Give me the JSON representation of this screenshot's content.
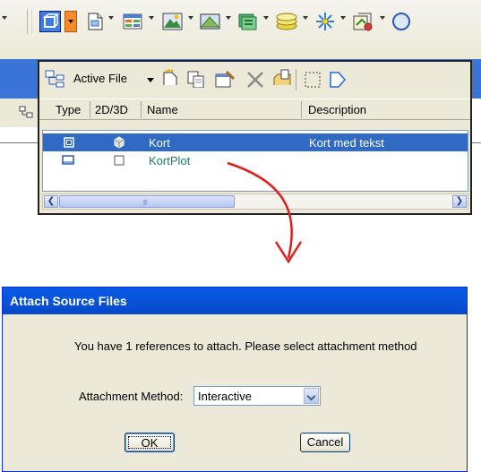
{
  "toolbar": {
    "icons": [
      "reference-icon",
      "models-icon",
      "level-manager-icon",
      "raster-manager-icon",
      "saved-views-icon",
      "layers-icon",
      "light-icon",
      "project-explorer-icon",
      "extra-icon"
    ]
  },
  "panel": {
    "source_label": "Active File",
    "columns": {
      "type": "Type",
      "dim": "2D/3D",
      "name": "Name",
      "description": "Description"
    },
    "rows": [
      {
        "name": "Kort",
        "description": "Kort med tekst",
        "selected": true
      },
      {
        "name": "KortPlot",
        "description": "",
        "selected": false
      }
    ]
  },
  "dialog": {
    "title": "Attach Source Files",
    "message": "You have 1 references to attach. Please select attachment method",
    "method_label": "Attachment Method:",
    "method_value": "Interactive",
    "ok_label": "OK",
    "cancel_label": "Cancel"
  },
  "colors": {
    "selection": "#316ac5",
    "titlebar": "#0a5ae6",
    "arrow": "#e02020",
    "active_dropdown": "#f68a2a"
  }
}
